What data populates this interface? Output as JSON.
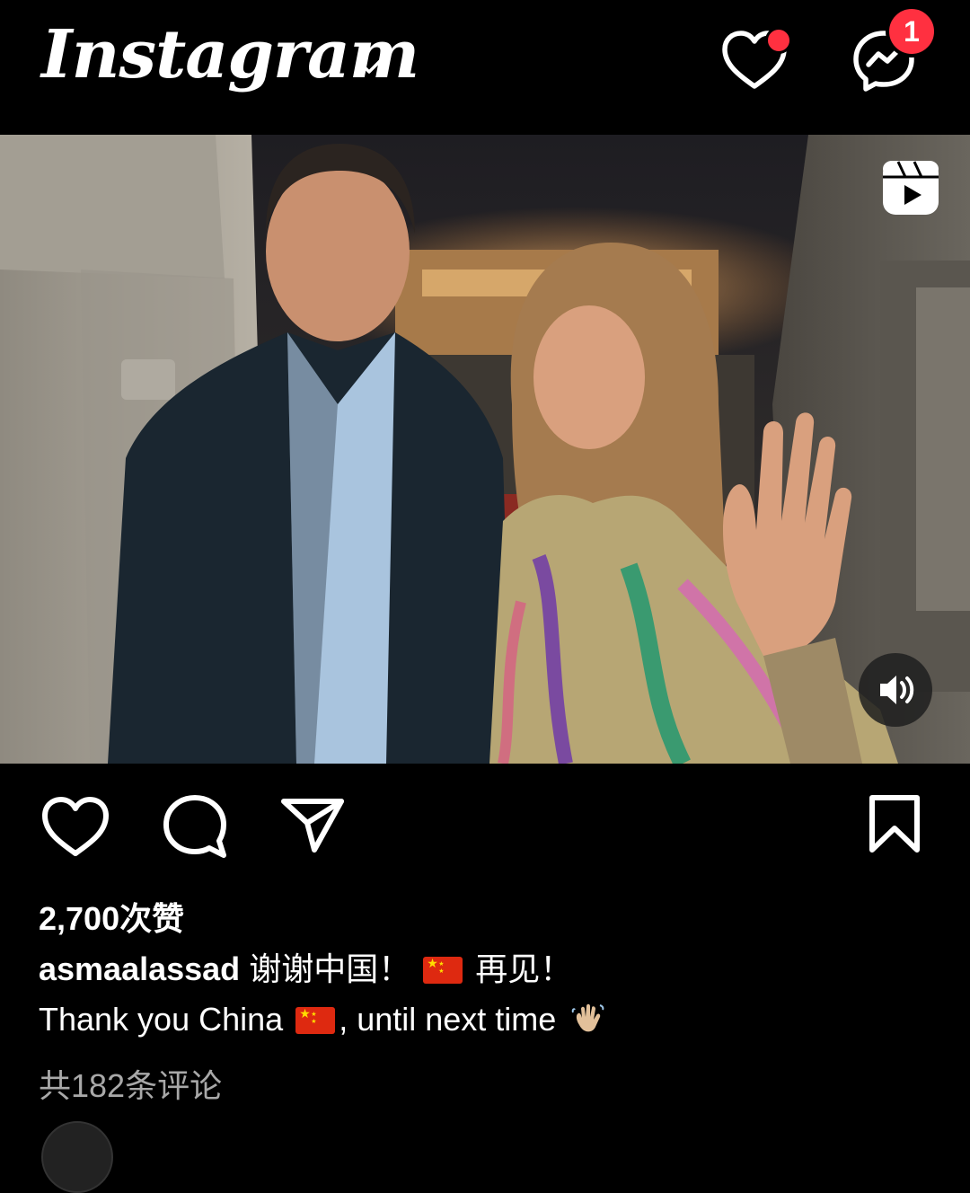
{
  "header": {
    "logo_text": "Instagram",
    "notification_badge": "1"
  },
  "post": {
    "likes_text": "2,700次赞",
    "username": "asmaalassad",
    "caption_line1": "谢谢中国！",
    "caption_line1_suffix": "再见！",
    "caption_line2_prefix": "Thank you China",
    "caption_line2_suffix": ", until next time",
    "comments_text": "共182条评论"
  },
  "colors": {
    "background": "#000000",
    "badge": "#ff3040",
    "secondary_text": "#a8a8a8"
  },
  "icons": [
    "chevron-down-icon",
    "heart-icon",
    "messenger-icon",
    "reel-icon",
    "sound-icon",
    "comment-icon",
    "share-icon",
    "bookmark-icon"
  ]
}
